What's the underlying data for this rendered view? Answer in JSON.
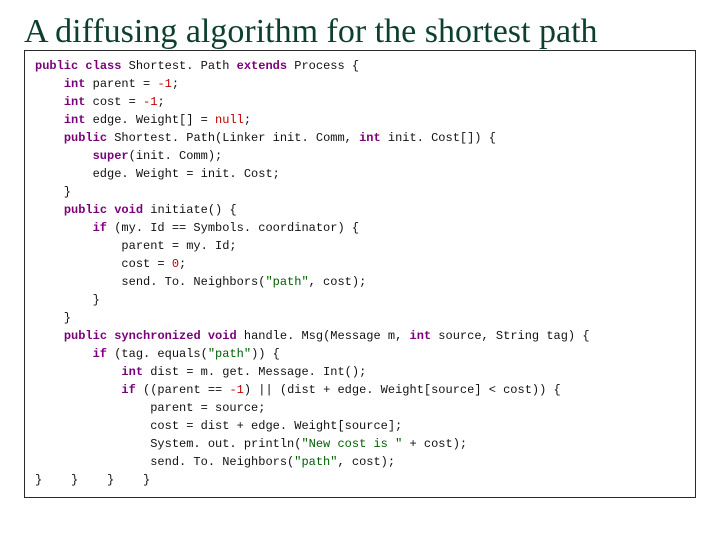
{
  "title": "A diffusing algorithm for the shortest path",
  "kw": {
    "public": "public",
    "class": "class",
    "extends": "extends",
    "int": "int",
    "void": "void",
    "synchronized": "synchronized",
    "super": "super",
    "if": "if",
    "null": "null"
  },
  "code": {
    "classDecl1": " Shortest. Path ",
    "classDecl2": " Process {",
    "parentDecl": " parent = ",
    "neg1a": "-1",
    "semi": ";",
    "costDecl": " cost = ",
    "neg1b": "-1",
    "edgeDecl": " edge. Weight[] = ",
    "ctor1": " Shortest. Path(Linker init. Comm, ",
    "ctor2": " init. Cost[]) {",
    "superCall": "(init. Comm);",
    "edgeAssign": "        edge. Weight = init. Cost;",
    "closeBrace": "    }",
    "initiateDecl": " initiate() {",
    "ifCoord": " (my. Id == Symbols. coordinator) {",
    "parentMyId": "            parent = my. Id;",
    "cost0a": "            cost = ",
    "zero": "0",
    "sendNb1a": "            send. To. Neighbors(",
    "pathStr": "\"path\"",
    "sendNb1b": ", cost);",
    "close2": "        }",
    "close1": "    }",
    "handleDecl1": " handle. Msg(Message m, ",
    "handleDecl2": " source, String tag) {",
    "ifTag1": " (tag. equals(",
    "ifTag2": ")) {",
    "distDecl": " dist = m. get. Message. Int();",
    "ifCond1": " ((parent == ",
    "neg1c": "-1",
    "ifCond2": ") || (dist + edge. Weight[source] < cost)) {",
    "parentSrc": "                parent = source;",
    "costSrc": "                cost = dist + edge. Weight[source];",
    "println1": "                System. out. println(",
    "newcostStr": "\"New cost is \"",
    "println2": " + cost);",
    "sendNb2a": "                send. To. Neighbors(",
    "sendNb2b": ", cost);",
    "finalClose": "}    }    }    }"
  }
}
